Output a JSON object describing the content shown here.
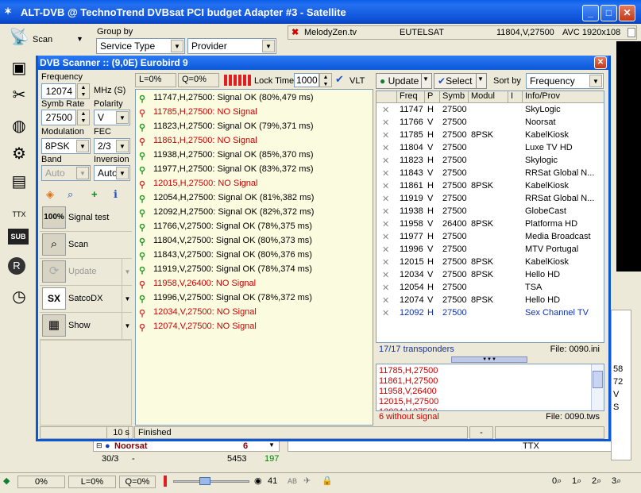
{
  "app": {
    "title": "ALT-DVB @ TechnoTrend DVBsat PCI budget Adapter #3 - Satellite"
  },
  "toolbar": {
    "scan_label": "Scan",
    "group_by_label": "Group by",
    "group_by_value": "Service Type",
    "group_sort_value": "Provider",
    "channel_name": "MelodyZen.tv",
    "channel_sat": "EUTELSAT",
    "channel_freq": "11804,V,27500",
    "channel_video": "AVC 1920x108"
  },
  "scanner": {
    "title": "DVB Scanner :: (9,0E) Eurobird 9",
    "frequency_label": "Frequency",
    "frequency_value": "12074",
    "frequency_unit": "MHz (S)",
    "symb_rate_label": "Symb Rate",
    "symb_rate_value": "27500",
    "polarity_label": "Polarity",
    "polarity_value": "V",
    "modulation_label": "Modulation",
    "modulation_value": "8PSK",
    "fec_label": "FEC",
    "fec_value": "2/3",
    "band_label": "Band",
    "band_value": "Auto",
    "inversion_label": "Inversion",
    "inversion_value": "Auto",
    "signal_test_label": "Signal test",
    "signal_test_icon": "100%",
    "scan_label": "Scan",
    "update_label": "Update",
    "satcodx_label": "SatcoDX",
    "show_label": "Show",
    "level_label": "L=0%",
    "quality_label": "Q=0%",
    "lock_time_label": "Lock Time",
    "lock_time_value": "1000",
    "vlt_label": "VLT",
    "update_button": "Update",
    "select_button": "Select",
    "sort_by_label": "Sort by",
    "sort_by_value": "Frequency",
    "log": [
      {
        "text": "11747,H,27500: Signal OK (80%,479 ms)",
        "ok": true
      },
      {
        "text": "11785,H,27500: NO Signal",
        "ok": false
      },
      {
        "text": "11823,H,27500: Signal OK (79%,371 ms)",
        "ok": true
      },
      {
        "text": "11861,H,27500: NO Signal",
        "ok": false
      },
      {
        "text": "11938,H,27500: Signal OK (85%,370 ms)",
        "ok": true
      },
      {
        "text": "11977,H,27500: Signal OK (83%,372 ms)",
        "ok": true
      },
      {
        "text": "12015,H,27500: NO Signal",
        "ok": false
      },
      {
        "text": "12054,H,27500: Signal OK (81%,382 ms)",
        "ok": true
      },
      {
        "text": "12092,H,27500: Signal OK (82%,372 ms)",
        "ok": true
      },
      {
        "text": "11766,V,27500: Signal OK (78%,375 ms)",
        "ok": true
      },
      {
        "text": "11804,V,27500: Signal OK (80%,373 ms)",
        "ok": true
      },
      {
        "text": "11843,V,27500: Signal OK (80%,376 ms)",
        "ok": true
      },
      {
        "text": "11919,V,27500: Signal OK (78%,374 ms)",
        "ok": true
      },
      {
        "text": "11958,V,26400: NO Signal",
        "ok": false
      },
      {
        "text": "11996,V,27500: Signal OK (78%,372 ms)",
        "ok": true
      },
      {
        "text": "12034,V,27500: NO Signal",
        "ok": false
      },
      {
        "text": "12074,V,27500: NO Signal",
        "ok": false
      }
    ],
    "columns": [
      "Freq",
      "P",
      "Symb",
      "Modul",
      "I",
      "Info/Prov"
    ],
    "transponders": [
      {
        "freq": "11747",
        "p": "H",
        "symb": "27500",
        "modul": "",
        "info": "SkyLogic"
      },
      {
        "freq": "11766",
        "p": "V",
        "symb": "27500",
        "modul": "",
        "info": "Noorsat"
      },
      {
        "freq": "11785",
        "p": "H",
        "symb": "27500",
        "modul": "8PSK",
        "info": "KabelKiosk"
      },
      {
        "freq": "11804",
        "p": "V",
        "symb": "27500",
        "modul": "",
        "info": "Luxe TV HD"
      },
      {
        "freq": "11823",
        "p": "H",
        "symb": "27500",
        "modul": "",
        "info": "Skylogic"
      },
      {
        "freq": "11843",
        "p": "V",
        "symb": "27500",
        "modul": "",
        "info": "RRSat Global N..."
      },
      {
        "freq": "11861",
        "p": "H",
        "symb": "27500",
        "modul": "8PSK",
        "info": "KabelKiosk"
      },
      {
        "freq": "11919",
        "p": "V",
        "symb": "27500",
        "modul": "",
        "info": "RRSat Global N..."
      },
      {
        "freq": "11938",
        "p": "H",
        "symb": "27500",
        "modul": "",
        "info": "GlobeCast"
      },
      {
        "freq": "11958",
        "p": "V",
        "symb": "26400",
        "modul": "8PSK",
        "info": "Platforma HD"
      },
      {
        "freq": "11977",
        "p": "H",
        "symb": "27500",
        "modul": "",
        "info": "Media Broadcast"
      },
      {
        "freq": "11996",
        "p": "V",
        "symb": "27500",
        "modul": "",
        "info": "MTV Portugal"
      },
      {
        "freq": "12015",
        "p": "H",
        "symb": "27500",
        "modul": "8PSK",
        "info": "KabelKiosk"
      },
      {
        "freq": "12034",
        "p": "V",
        "symb": "27500",
        "modul": "8PSK",
        "info": "Hello HD"
      },
      {
        "freq": "12054",
        "p": "H",
        "symb": "27500",
        "modul": "",
        "info": "TSA"
      },
      {
        "freq": "12074",
        "p": "V",
        "symb": "27500",
        "modul": "8PSK",
        "info": "Hello HD"
      },
      {
        "freq": "12092",
        "p": "H",
        "symb": "27500",
        "modul": "",
        "info": "Sex Channel TV"
      }
    ],
    "transponder_count": "17/17 transponders",
    "file_ini": "File: 0090.ini",
    "no_signal_list": [
      "11785,H,27500",
      "11861,H,27500",
      "11958,V,26400",
      "12015,H,27500",
      "12034,V,27500"
    ],
    "no_signal_count": "6 without signal",
    "file_tws": "File: 0090.tws",
    "status_time": "10 s",
    "status_text": "Finished",
    "status_dash": "-"
  },
  "background": {
    "group_name": "Noorsat",
    "group_count": "6",
    "counter": "30/3",
    "dash": "-",
    "num1": "5453",
    "num2": "197",
    "ttx": "TTX",
    "right_nums": [
      "58",
      "72",
      "V",
      "S"
    ]
  },
  "statusbar": {
    "percent": "0%",
    "level": "L=0%",
    "quality": "Q=0%",
    "volume": "41",
    "ab": "AB",
    "zoom": [
      "0",
      "1",
      "2",
      "3"
    ]
  }
}
